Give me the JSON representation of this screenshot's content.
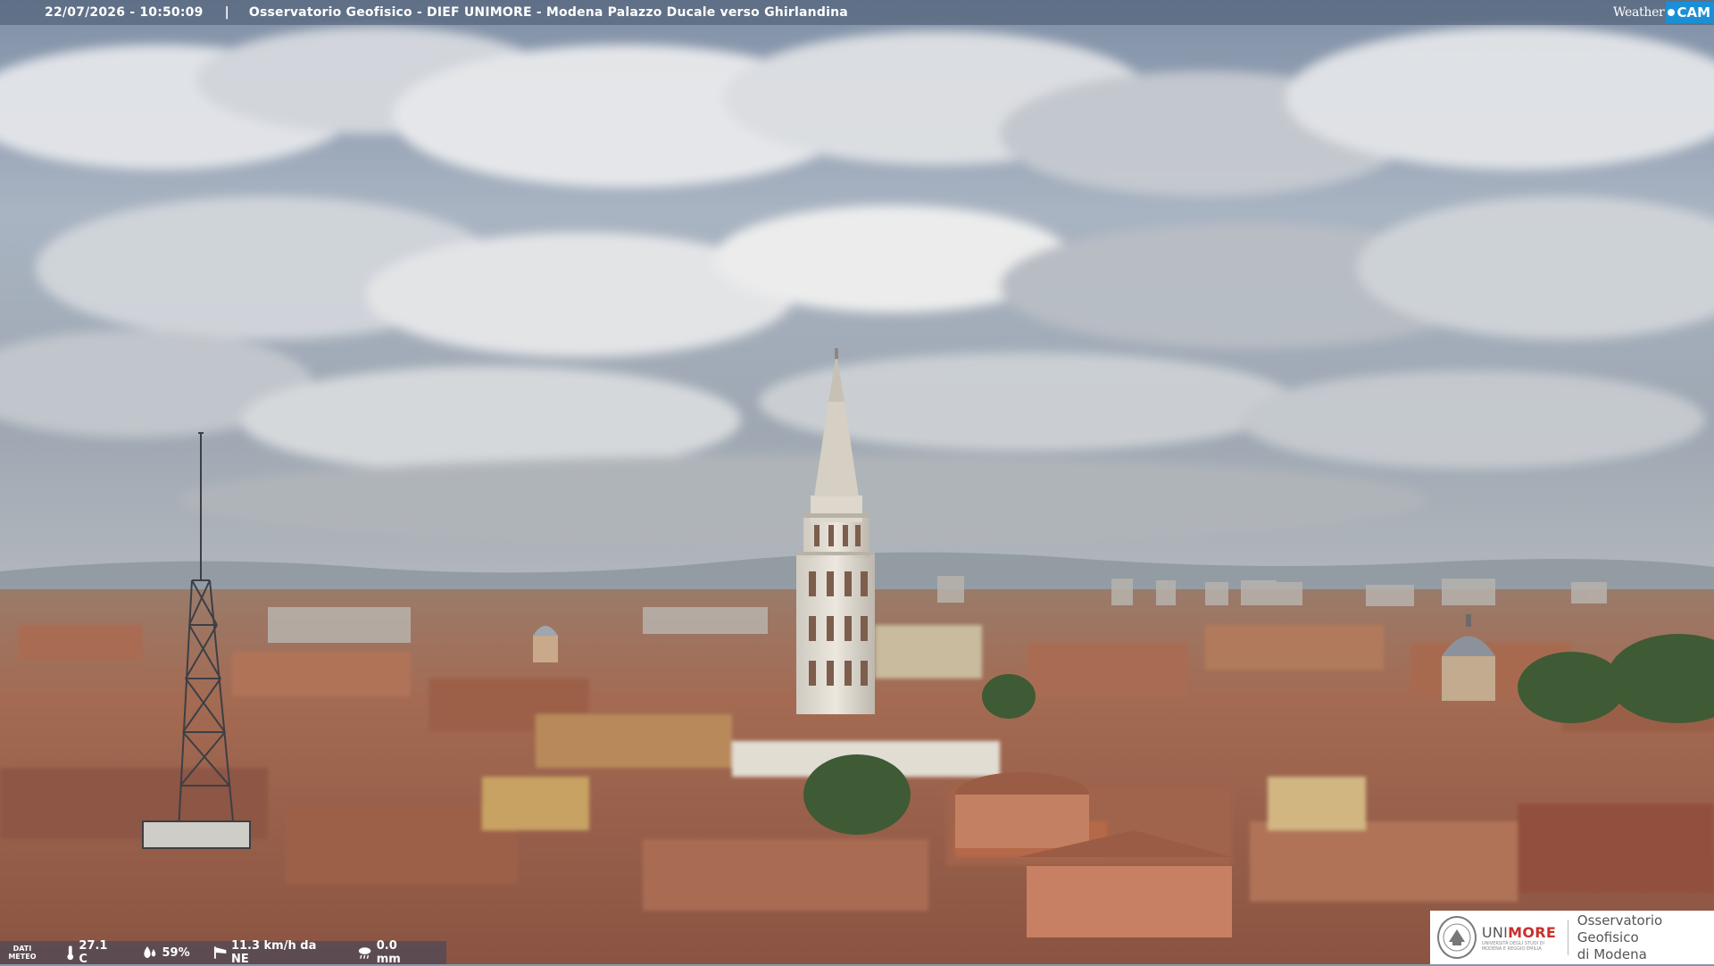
{
  "header": {
    "datetime": "22/07/2026 - 10:50:09",
    "separator": "|",
    "caption": "Osservatorio Geofisico - DIEF UNIMORE - Modena Palazzo Ducale verso Ghirlandina"
  },
  "brand": {
    "weather_text": "Weather",
    "cam_text": "CAM"
  },
  "weather": {
    "label_line1": "DATI",
    "label_line2": "METEO",
    "temperature": "27.1 C",
    "humidity": "59%",
    "wind": "11.3 km/h da NE",
    "rain": "0.0 mm",
    "icons": [
      "thermometer-icon",
      "humidity-drop-icon",
      "wind-sock-icon",
      "rain-cloud-icon"
    ]
  },
  "logo": {
    "uni_prefix": "UNI",
    "uni_suffix": "MORE",
    "uni_subtitle": "UNIVERSITÀ DEGLI STUDI DI MODENA E REGGIO EMILIA",
    "obs_line1": "Osservatorio Geofisico",
    "obs_line2": "di Modena"
  },
  "colors": {
    "brand_blue": "#1b8fd6",
    "unimore_red": "#c9302c",
    "roof_terracotta": "#a8644a"
  }
}
